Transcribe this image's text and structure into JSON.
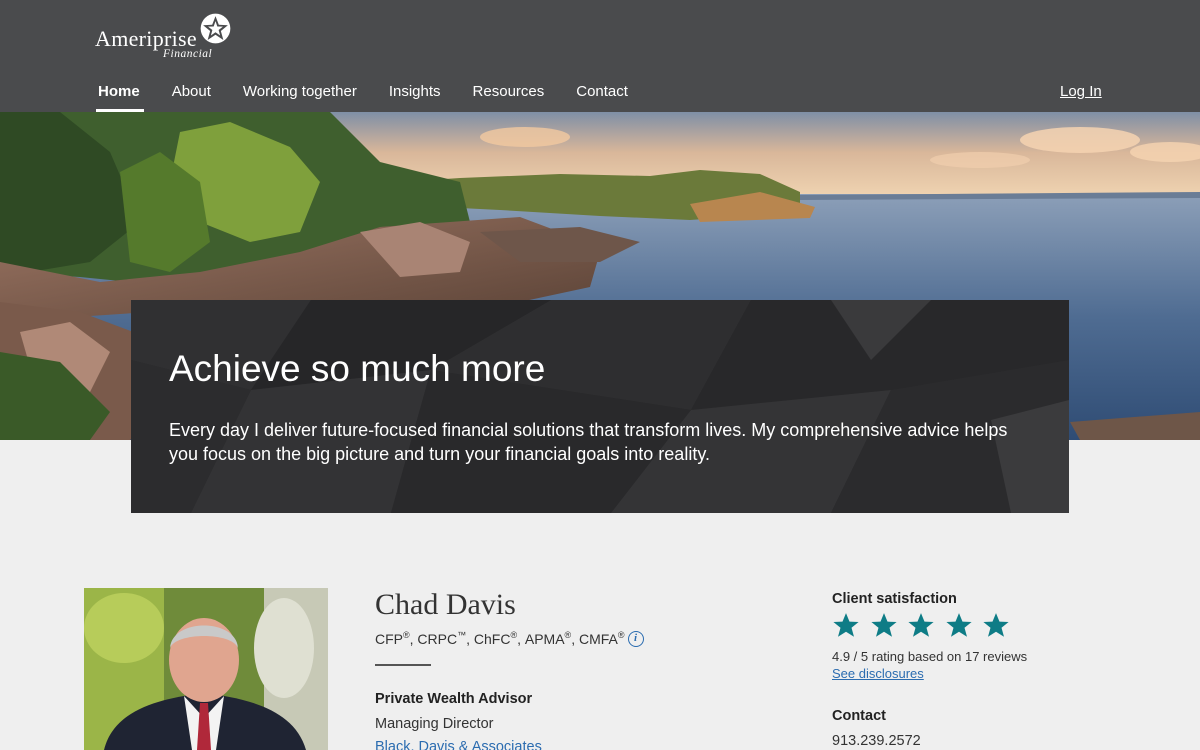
{
  "brand": {
    "wordmark": "Ameriprise",
    "submark": "Financial"
  },
  "nav": {
    "items": [
      {
        "label": "Home",
        "active": true
      },
      {
        "label": "About",
        "active": false
      },
      {
        "label": "Working together",
        "active": false
      },
      {
        "label": "Insights",
        "active": false
      },
      {
        "label": "Resources",
        "active": false
      },
      {
        "label": "Contact",
        "active": false
      }
    ],
    "login_label": "Log In"
  },
  "hero": {
    "title": "Achieve so much more",
    "text": "Every day I deliver future-focused financial solutions that transform lives. My comprehensive advice helps you focus on the big picture and turn your financial goals into reality."
  },
  "advisor": {
    "name": "Chad Davis",
    "credentials": [
      {
        "text": "CFP",
        "mark": "®"
      },
      {
        "text": "CRPC",
        "mark": "™"
      },
      {
        "text": "ChFC",
        "mark": "®"
      },
      {
        "text": "APMA",
        "mark": "®"
      },
      {
        "text": "CMFA",
        "mark": "®"
      }
    ],
    "info_glyph": "i",
    "role": "Private Wealth Advisor",
    "title": "Managing Director",
    "firm": "Black, Davis & Associates"
  },
  "satisfaction": {
    "heading": "Client satisfaction",
    "stars": 5,
    "rating_text": "4.9 / 5 rating based on 17 reviews",
    "disclosures_label": "See disclosures"
  },
  "contact": {
    "heading": "Contact",
    "phone": "913.239.2572"
  },
  "colors": {
    "header_bg": "#4a4b4d",
    "page_bg": "#efefef",
    "star": "#0e7c86",
    "link": "#2b6cb0",
    "banner_bg": "#2a2a2b"
  }
}
